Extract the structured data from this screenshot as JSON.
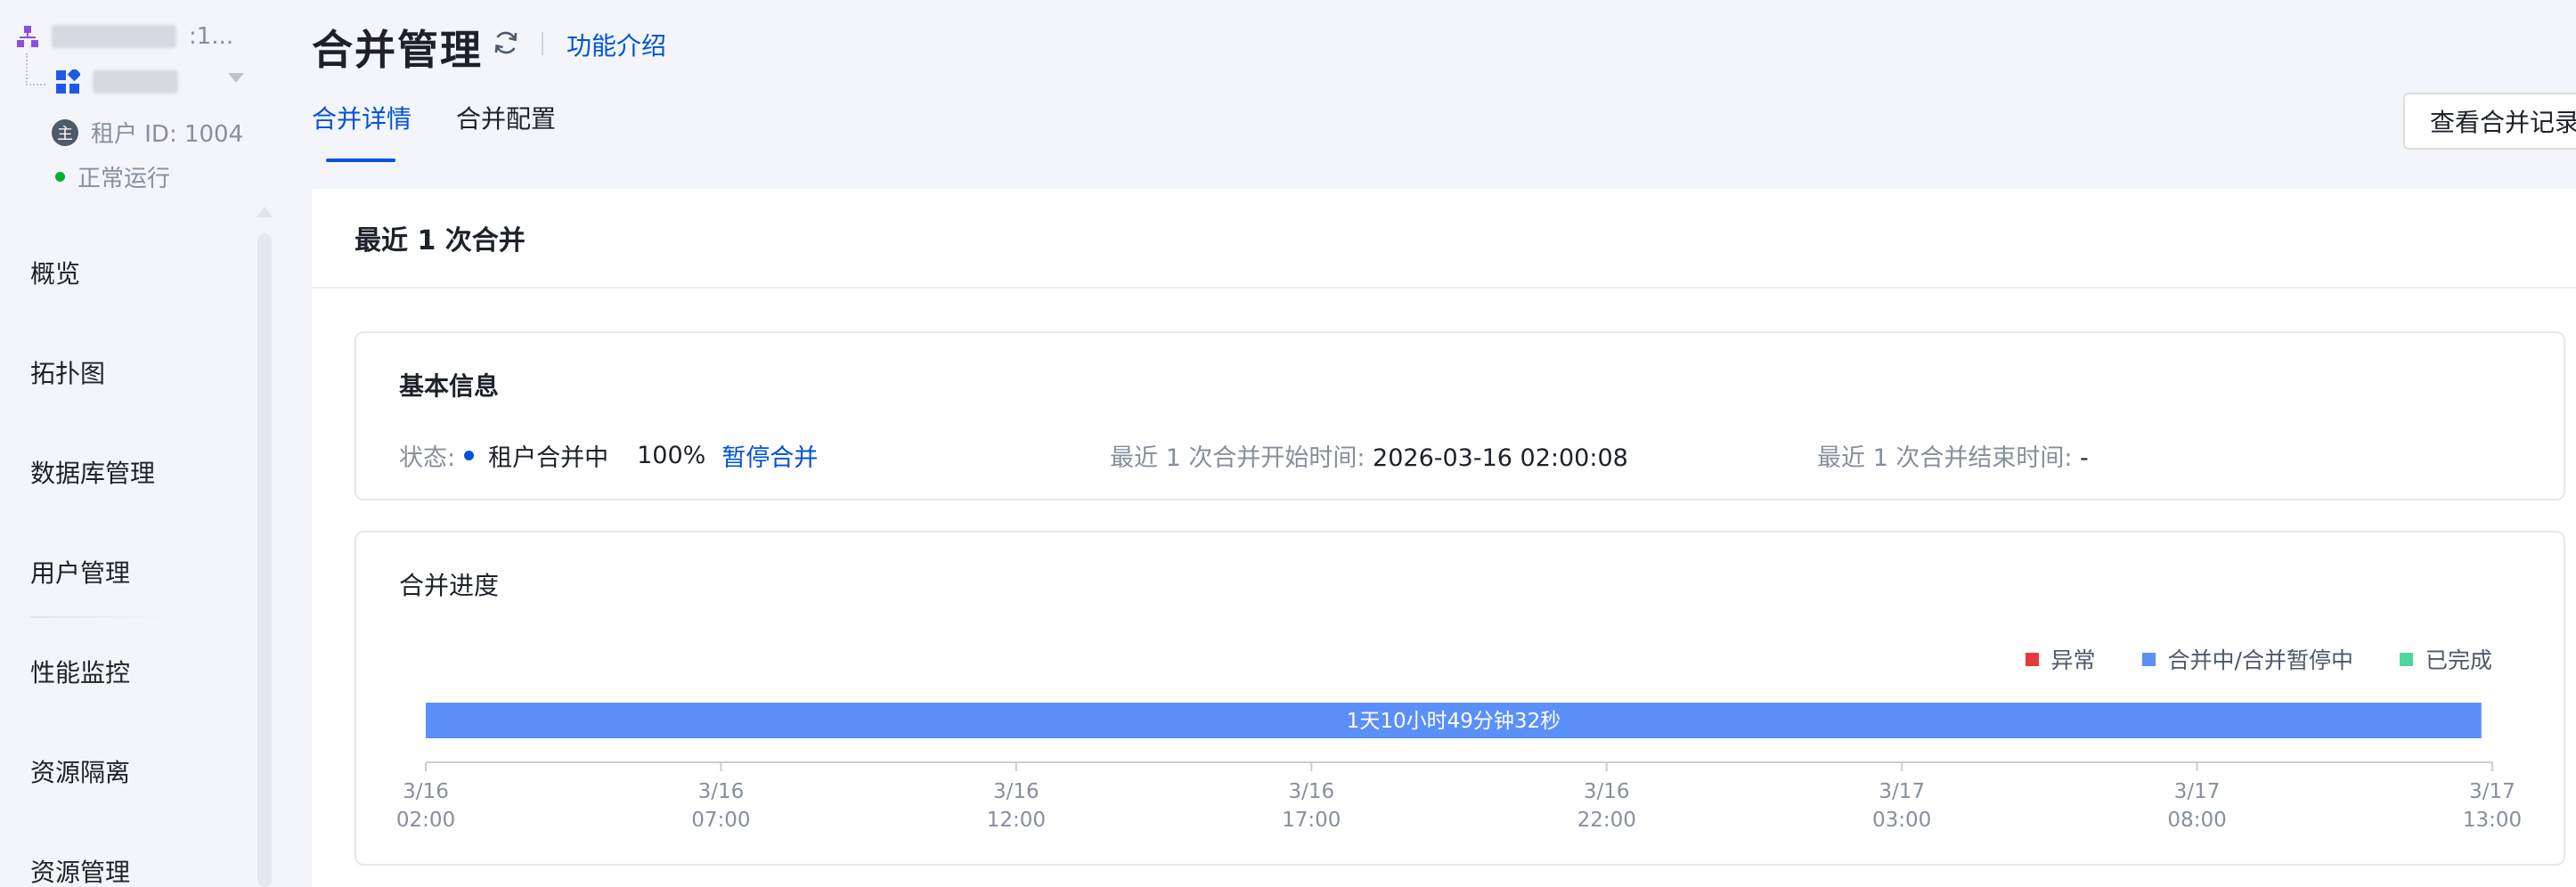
{
  "sidebar": {
    "tenant_suffix": ":1...",
    "tenant_id": "租户 ID: 1004",
    "badge": "主",
    "status": "正常运行",
    "nav": [
      {
        "label": "概览"
      },
      {
        "label": "拓扑图"
      },
      {
        "label": "数据库管理"
      },
      {
        "label": "用户管理"
      },
      {
        "label": "性能监控"
      },
      {
        "label": "资源隔离"
      },
      {
        "label": "资源管理"
      }
    ]
  },
  "header": {
    "title": "合并管理",
    "func_link": "功能介绍",
    "tabs": [
      {
        "label": "合并详情",
        "active": true
      },
      {
        "label": "合并配置",
        "active": false
      }
    ],
    "record_button": "查看合并记录"
  },
  "card": {
    "title": "最近 1 次合并",
    "basic": {
      "title": "基本信息",
      "status_label": "状态:",
      "status_value": "租户合并中",
      "percent": "100%",
      "pause_link": "暂停合并",
      "start_label": "最近 1 次合并开始时间:",
      "start_value": "2026-03-16 02:00:08",
      "end_label": "最近 1 次合并结束时间:",
      "end_value": "-"
    },
    "progress": {
      "title": "合并进度",
      "legend": [
        {
          "label": "异常",
          "color": "#e63a3a"
        },
        {
          "label": "合并中/合并暂停中",
          "color": "#5b8ff9"
        },
        {
          "label": "已完成",
          "color": "#4dd69d"
        }
      ]
    }
  },
  "chart_data": {
    "type": "timeline",
    "bar_label": "1天10小时49分钟32秒",
    "bar_color": "#5b8ff9",
    "ticks": [
      {
        "date": "3/16",
        "time": "02:00"
      },
      {
        "date": "3/16",
        "time": "07:00"
      },
      {
        "date": "3/16",
        "time": "12:00"
      },
      {
        "date": "3/16",
        "time": "17:00"
      },
      {
        "date": "3/16",
        "time": "22:00"
      },
      {
        "date": "3/17",
        "time": "03:00"
      },
      {
        "date": "3/17",
        "time": "08:00"
      },
      {
        "date": "3/17",
        "time": "13:00"
      }
    ],
    "bar_start": "3/16 02:00",
    "bar_end": "3/17 12:49"
  },
  "colors": {
    "accent": "#0052d9",
    "running": "#00b42a"
  }
}
